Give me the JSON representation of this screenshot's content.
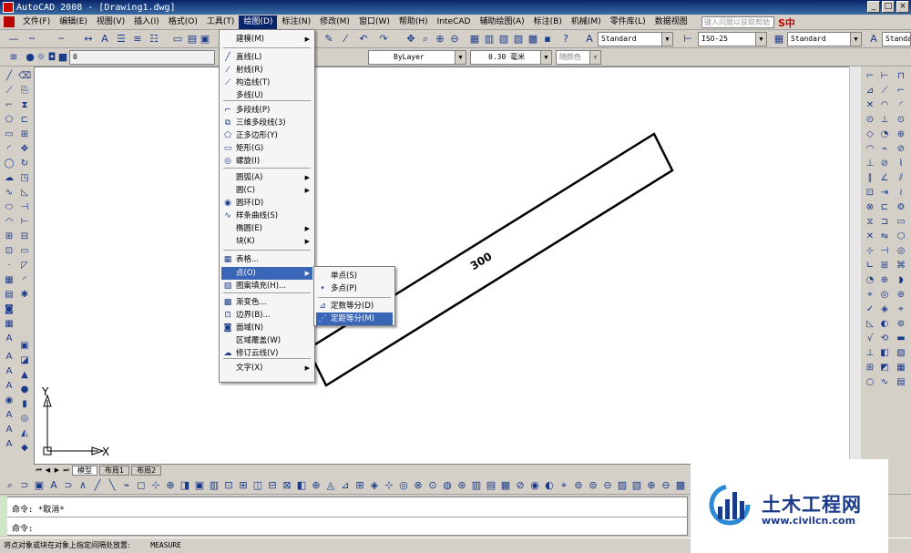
{
  "window": {
    "title": "AutoCAD 2008 - [Drawing1.dwg]"
  },
  "menubar": {
    "items": [
      "文件(F)",
      "编辑(E)",
      "视图(V)",
      "插入(I)",
      "格式(O)",
      "工具(T)",
      "绘图(D)",
      "标注(N)",
      "修改(M)",
      "窗口(W)",
      "帮助(H)",
      "InteCAD",
      "辅助绘图(A)",
      "标注(B)",
      "机械(M)",
      "零件库(L)",
      "数据视图"
    ],
    "help_placeholder": "键入问题以获取帮助",
    "brand": "S中"
  },
  "toolbar": {
    "text_style": "Standard",
    "dim_style": "ISO-25",
    "table_style": "Standard",
    "layer": "0",
    "linetype": "ByLayer",
    "lineweight": "0.30 毫米",
    "plot_style": "随颜色"
  },
  "draw_menu": {
    "items": [
      {
        "label": "建模(M)",
        "icon": "",
        "submenu": true
      },
      {
        "label": "直线(L)",
        "icon": "line-icon"
      },
      {
        "label": "射线(R)",
        "icon": "ray-icon"
      },
      {
        "label": "构造线(T)",
        "icon": "xline-icon"
      },
      {
        "label": "多线(U)",
        "icon": ""
      },
      {
        "label": "多段线(P)",
        "icon": "polyline-icon"
      },
      {
        "label": "三维多段线(3)",
        "icon": "3dpoly-icon"
      },
      {
        "label": "正多边形(Y)",
        "icon": "polygon-icon"
      },
      {
        "label": "矩形(G)",
        "icon": "rectangle-icon"
      },
      {
        "label": "螺旋(I)",
        "icon": "helix-icon"
      },
      {
        "label": "圆弧(A)",
        "icon": "",
        "submenu": true
      },
      {
        "label": "圆(C)",
        "icon": "",
        "submenu": true
      },
      {
        "label": "圆环(D)",
        "icon": "donut-icon"
      },
      {
        "label": "样条曲线(S)",
        "icon": "spline-icon"
      },
      {
        "label": "椭圆(E)",
        "icon": "",
        "submenu": true
      },
      {
        "label": "块(K)",
        "icon": "",
        "submenu": true
      },
      {
        "label": "表格...",
        "icon": "table-icon"
      },
      {
        "label": "点(O)",
        "icon": "",
        "submenu": true,
        "highlighted": true
      },
      {
        "label": "图案填充(H)...",
        "icon": "hatch-icon"
      },
      {
        "label": "渐变色...",
        "icon": "gradient-icon"
      },
      {
        "label": "边界(B)...",
        "icon": "boundary-icon"
      },
      {
        "label": "面域(N)",
        "icon": "region-icon"
      },
      {
        "label": "区域覆盖(W)",
        "icon": ""
      },
      {
        "label": "修订云线(V)",
        "icon": "revcloud-icon"
      },
      {
        "label": "文字(X)",
        "icon": "",
        "submenu": true
      }
    ]
  },
  "point_submenu": {
    "items": [
      {
        "label": "单点(S)",
        "icon": ""
      },
      {
        "label": "多点(P)",
        "icon": "point-icon"
      },
      {
        "label": "定数等分(D)",
        "icon": "divide-icon"
      },
      {
        "label": "定距等分(M)",
        "icon": "measure-icon",
        "highlighted": true
      }
    ]
  },
  "drawing": {
    "dimension_text": "300",
    "axis_x": "X",
    "axis_y": "Y"
  },
  "layout_tabs": [
    "模型",
    "布局1",
    "布局2"
  ],
  "command": {
    "line1": "命令: *取消*",
    "line2": "命令:"
  },
  "status": {
    "prompt": "将点对象或块在对象上指定间隔处放置:",
    "command": "MEASURE"
  },
  "watermark": {
    "title": "土木工程网",
    "url": "www.civilcn.com"
  }
}
